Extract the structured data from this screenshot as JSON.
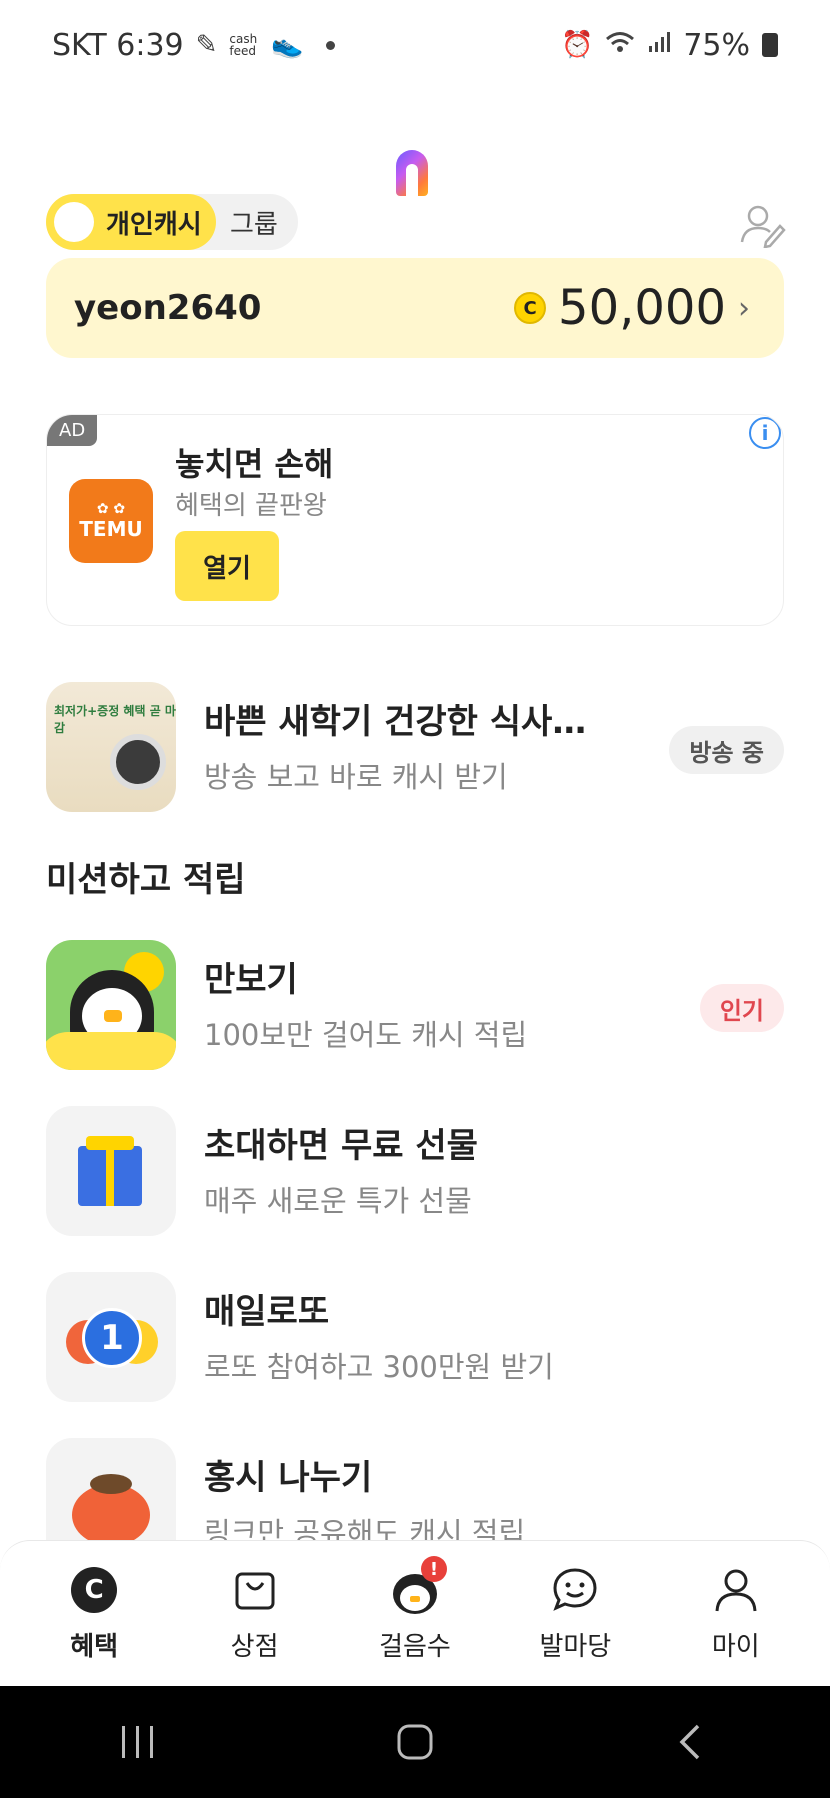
{
  "status_bar": {
    "carrier_time": "SKT 6:39",
    "icon_labels": "cash feed",
    "battery": "75%"
  },
  "toggle": {
    "personal": "개인캐시",
    "group": "그룹"
  },
  "user": {
    "name": "yeon2640",
    "coin_symbol": "C",
    "cash": "50,000"
  },
  "ad": {
    "tag": "AD",
    "info": "i",
    "brand": "TEMU",
    "title": "놓치면 손해",
    "subtitle": "혜택의 끝판왕",
    "cta": "열기"
  },
  "live": {
    "title": "바쁜 새학기 건강한 식사…",
    "subtitle": "방송 보고 바로 캐시 받기",
    "badge": "방송 중",
    "thumb_text": "최저가+증정 혜택 곧 마감"
  },
  "section": {
    "title": "미션하고 적립"
  },
  "missions": [
    {
      "title": "만보기",
      "subtitle": "100보만 걸어도 캐시 적립",
      "badge": "인기",
      "icon": "penguin-icon"
    },
    {
      "title": "초대하면 무료 선물",
      "subtitle": "매주 새로운 특가 선물",
      "icon": "gift-icon"
    },
    {
      "title": "매일로또",
      "subtitle": "로또 참여하고 300만원 받기",
      "ball": "1",
      "icon": "lotto-icon"
    },
    {
      "title": "홍시 나누기",
      "subtitle": "링크만 공유해도 캐시 적립",
      "icon": "persimmon-icon"
    }
  ],
  "tabbar": [
    {
      "label": "혜택",
      "icon": "benefit-icon",
      "active": true
    },
    {
      "label": "상점",
      "icon": "shopping-bag-icon"
    },
    {
      "label": "걸음수",
      "icon": "penguin-icon",
      "alert": "!"
    },
    {
      "label": "발마당",
      "icon": "chat-icon"
    },
    {
      "label": "마이",
      "icon": "person-icon"
    }
  ],
  "colors": {
    "accent": "#ffe24a",
    "card_bg": "#fff7cf",
    "temu": "#f27a1a",
    "alert": "#e8403a"
  }
}
